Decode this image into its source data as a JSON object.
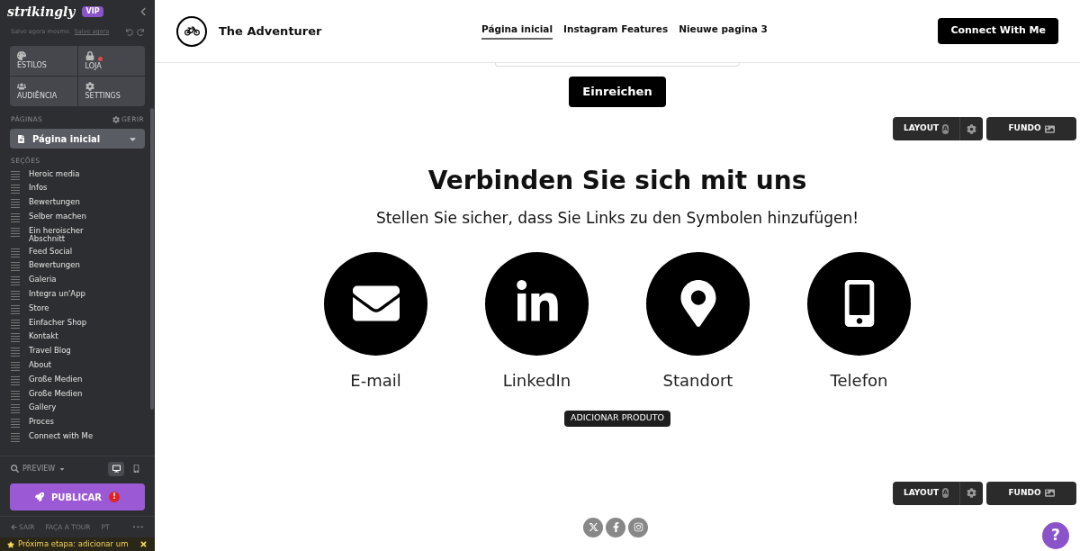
{
  "sidebar": {
    "logo": "strikingly",
    "badge": "VIP",
    "save_status": "Salvo agora mesmo.",
    "save_link": "Salve agora",
    "tools": [
      {
        "kind": "styles",
        "label": "ESTILOS",
        "notification": false
      },
      {
        "kind": "store",
        "label": "LOJA",
        "notification": true
      },
      {
        "kind": "audience",
        "label": "AUDIÊNCIA",
        "notification": false
      },
      {
        "kind": "settings",
        "label": "SETTINGS",
        "notification": false
      }
    ],
    "pages_label": "PÁGINAS",
    "manage": "GERIR",
    "page_select": "Página inicial",
    "sections_label": "SEÇÕES",
    "sections": [
      "Heroic media",
      "Infos",
      "Bewertungen",
      "Selber machen",
      "Ein heroischer Abschnitt",
      "Feed Social",
      "Bewertungen",
      "Galeria",
      "Integra un'App",
      "Store",
      "Einfacher Shop",
      "Kontakt",
      "Travel Blog",
      "About",
      "Große Medien",
      "Große Medien",
      "Gallery",
      "Proces",
      "Connect with Me"
    ],
    "preview": "PREVIEW",
    "devices": [
      {
        "kind": "desktop",
        "selected": true
      },
      {
        "kind": "mobile",
        "selected": false
      }
    ],
    "publish": "PUBLICAR",
    "publish_alert": "!",
    "footer_links": [
      {
        "kind": "exit",
        "label": "SAIR"
      },
      {
        "kind": "text",
        "label": "FAÇA A TOUR"
      },
      {
        "kind": "text",
        "label": "PT"
      },
      {
        "kind": "text",
        "label": "•••"
      }
    ],
    "next_step": "Próxima etapa: adicionar um"
  },
  "header": {
    "site_title": "The Adventurer",
    "nav": [
      {
        "label": "Página inicial",
        "selected": true
      },
      {
        "label": "Instagram Features",
        "selected": false
      },
      {
        "label": "Nieuwe pagina 3",
        "selected": false
      }
    ],
    "cta": "Connect With Me"
  },
  "form": {
    "submit": "Einreichen"
  },
  "section_toolbars": [
    {
      "layout": "LAYOUT",
      "layout_badge": "A",
      "background": "FUNDO"
    },
    {
      "layout": "LAYOUT",
      "layout_badge": "A",
      "background": "FUNDO"
    }
  ],
  "contact": {
    "title": "Verbinden Sie sich mit uns",
    "subtitle": "Stellen Sie sicher, dass Sie Links zu den Symbolen hinzufügen!",
    "items": [
      {
        "kind": "email",
        "label": "E-mail"
      },
      {
        "kind": "linkedin",
        "label": "LinkedIn"
      },
      {
        "kind": "location",
        "label": "Standort"
      },
      {
        "kind": "phone",
        "label": "Telefon"
      }
    ],
    "add_product": "ADICIONAR PRODUTO"
  },
  "footer": {
    "social": [
      {
        "kind": "x"
      },
      {
        "kind": "facebook"
      },
      {
        "kind": "instagram"
      }
    ]
  },
  "help": "?"
}
